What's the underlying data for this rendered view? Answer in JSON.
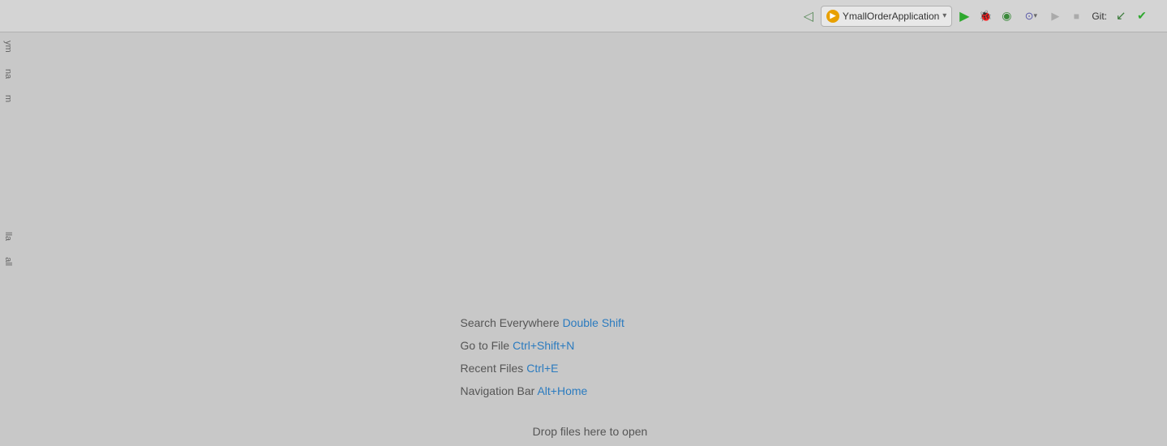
{
  "toolbar": {
    "back_icon": "◁",
    "run_config_icon": "▶",
    "run_config_label": "YmallOrderApplication",
    "dropdown_arrow": "▾",
    "run_icon": "▶",
    "debug_icon": "🐞",
    "coverage_icon": "◉",
    "profile_icon": "⊙",
    "more_icon": "▾",
    "stop_run_icon": "▶",
    "stop_icon": "■",
    "git_label": "Git:",
    "git_update_icon": "↙",
    "git_commit_icon": "✔"
  },
  "sidebar": {
    "items": [
      {
        "label": "ym"
      },
      {
        "label": "na"
      },
      {
        "label": "m"
      },
      {
        "label": "lla"
      },
      {
        "label": "all"
      }
    ]
  },
  "hints": [
    {
      "prefix": "Search Everywhere",
      "shortcut": "Double Shift"
    },
    {
      "prefix": "Go to File",
      "shortcut": "Ctrl+Shift+N"
    },
    {
      "prefix": "Recent Files",
      "shortcut": "Ctrl+E"
    },
    {
      "prefix": "Navigation Bar",
      "shortcut": "Alt+Home"
    }
  ],
  "drop_zone_label": "Drop files here to open"
}
